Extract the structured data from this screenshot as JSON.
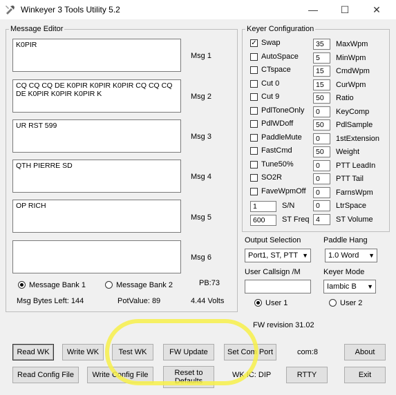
{
  "window": {
    "title": "Winkeyer 3 Tools Utility 5.2",
    "minimize": "—",
    "maximize": "☐",
    "close": "✕"
  },
  "message_editor": {
    "label": "Message Editor",
    "messages": [
      {
        "text": "K0PIR",
        "label": "Msg 1"
      },
      {
        "text": "CQ CQ CQ DE K0PIR K0PIR K0PIR CQ CQ CQ DE K0PIR K0PIR K0PIR K",
        "label": "Msg 2"
      },
      {
        "text": "UR RST 599",
        "label": "Msg 3"
      },
      {
        "text": "QTH PIERRE SD",
        "label": "Msg 4"
      },
      {
        "text": "OP RICH",
        "label": "Msg 5"
      },
      {
        "text": "",
        "label": "Msg 6"
      }
    ],
    "bank1": "Message Bank 1",
    "bank2": "Message Bank 2",
    "pb": "PB:73",
    "bytes_left": "Msg Bytes Left: 144",
    "pot_value": "PotValue: 89",
    "volts": "4.44 Volts"
  },
  "keyer_config": {
    "label": "Keyer Configuration",
    "checkboxes": [
      {
        "label": "Swap",
        "checked": true
      },
      {
        "label": "AutoSpace",
        "checked": false
      },
      {
        "label": "CTspace",
        "checked": false
      },
      {
        "label": "Cut 0",
        "checked": false
      },
      {
        "label": "Cut 9",
        "checked": false
      },
      {
        "label": "PdlToneOnly",
        "checked": false
      },
      {
        "label": "PdlWDoff",
        "checked": false
      },
      {
        "label": "PaddleMute",
        "checked": false
      },
      {
        "label": "FastCmd",
        "checked": false
      },
      {
        "label": "Tune50%",
        "checked": false
      },
      {
        "label": "SO2R",
        "checked": false
      },
      {
        "label": "FaveWpmOff",
        "checked": false
      }
    ],
    "sn_value": "1",
    "sn_label": "S/N",
    "stfreq_value": "600",
    "stfreq_label": "ST Freq",
    "params": [
      {
        "value": "35",
        "label": "MaxWpm"
      },
      {
        "value": "5",
        "label": "MinWpm"
      },
      {
        "value": "15",
        "label": "CmdWpm"
      },
      {
        "value": "15",
        "label": "CurWpm"
      },
      {
        "value": "50",
        "label": "Ratio"
      },
      {
        "value": "0",
        "label": "KeyComp"
      },
      {
        "value": "50",
        "label": "PdlSample"
      },
      {
        "value": "0",
        "label": "1stExtension"
      },
      {
        "value": "50",
        "label": "Weight"
      },
      {
        "value": "0",
        "label": "PTT LeadIn"
      },
      {
        "value": "0",
        "label": "PTT Tail"
      },
      {
        "value": "0",
        "label": "FarnsWpm"
      },
      {
        "value": "0",
        "label": "LtrSpace"
      },
      {
        "value": "4",
        "label": "ST Volume"
      }
    ],
    "output_selection_label": "Output Selection",
    "output_selection_value": "Port1, ST, PTT",
    "paddle_hang_label": "Paddle Hang",
    "paddle_hang_value": "1.0 Word",
    "user_callsign_label": "User Callsign /M",
    "user_callsign_value": "",
    "keyer_mode_label": "Keyer Mode",
    "keyer_mode_value": "Iambic B",
    "user1": "User 1",
    "user2": "User 2"
  },
  "fw_revision": "FW revision 31.02",
  "buttons": {
    "read_wk": "Read WK",
    "write_wk": "Write WK",
    "test_wk": "Test WK",
    "fw_update": "FW Update",
    "set_com_port": "Set Com Port",
    "about": "About",
    "read_config": "Read Config File",
    "write_config": "Write Config File",
    "reset_defaults": "Reset to Defaults",
    "rtty": "RTTY",
    "exit": "Exit"
  },
  "com_port": "com:8",
  "wk_ic": "WK IC: DIP",
  "colors": {
    "highlight": "#f7f04a"
  }
}
